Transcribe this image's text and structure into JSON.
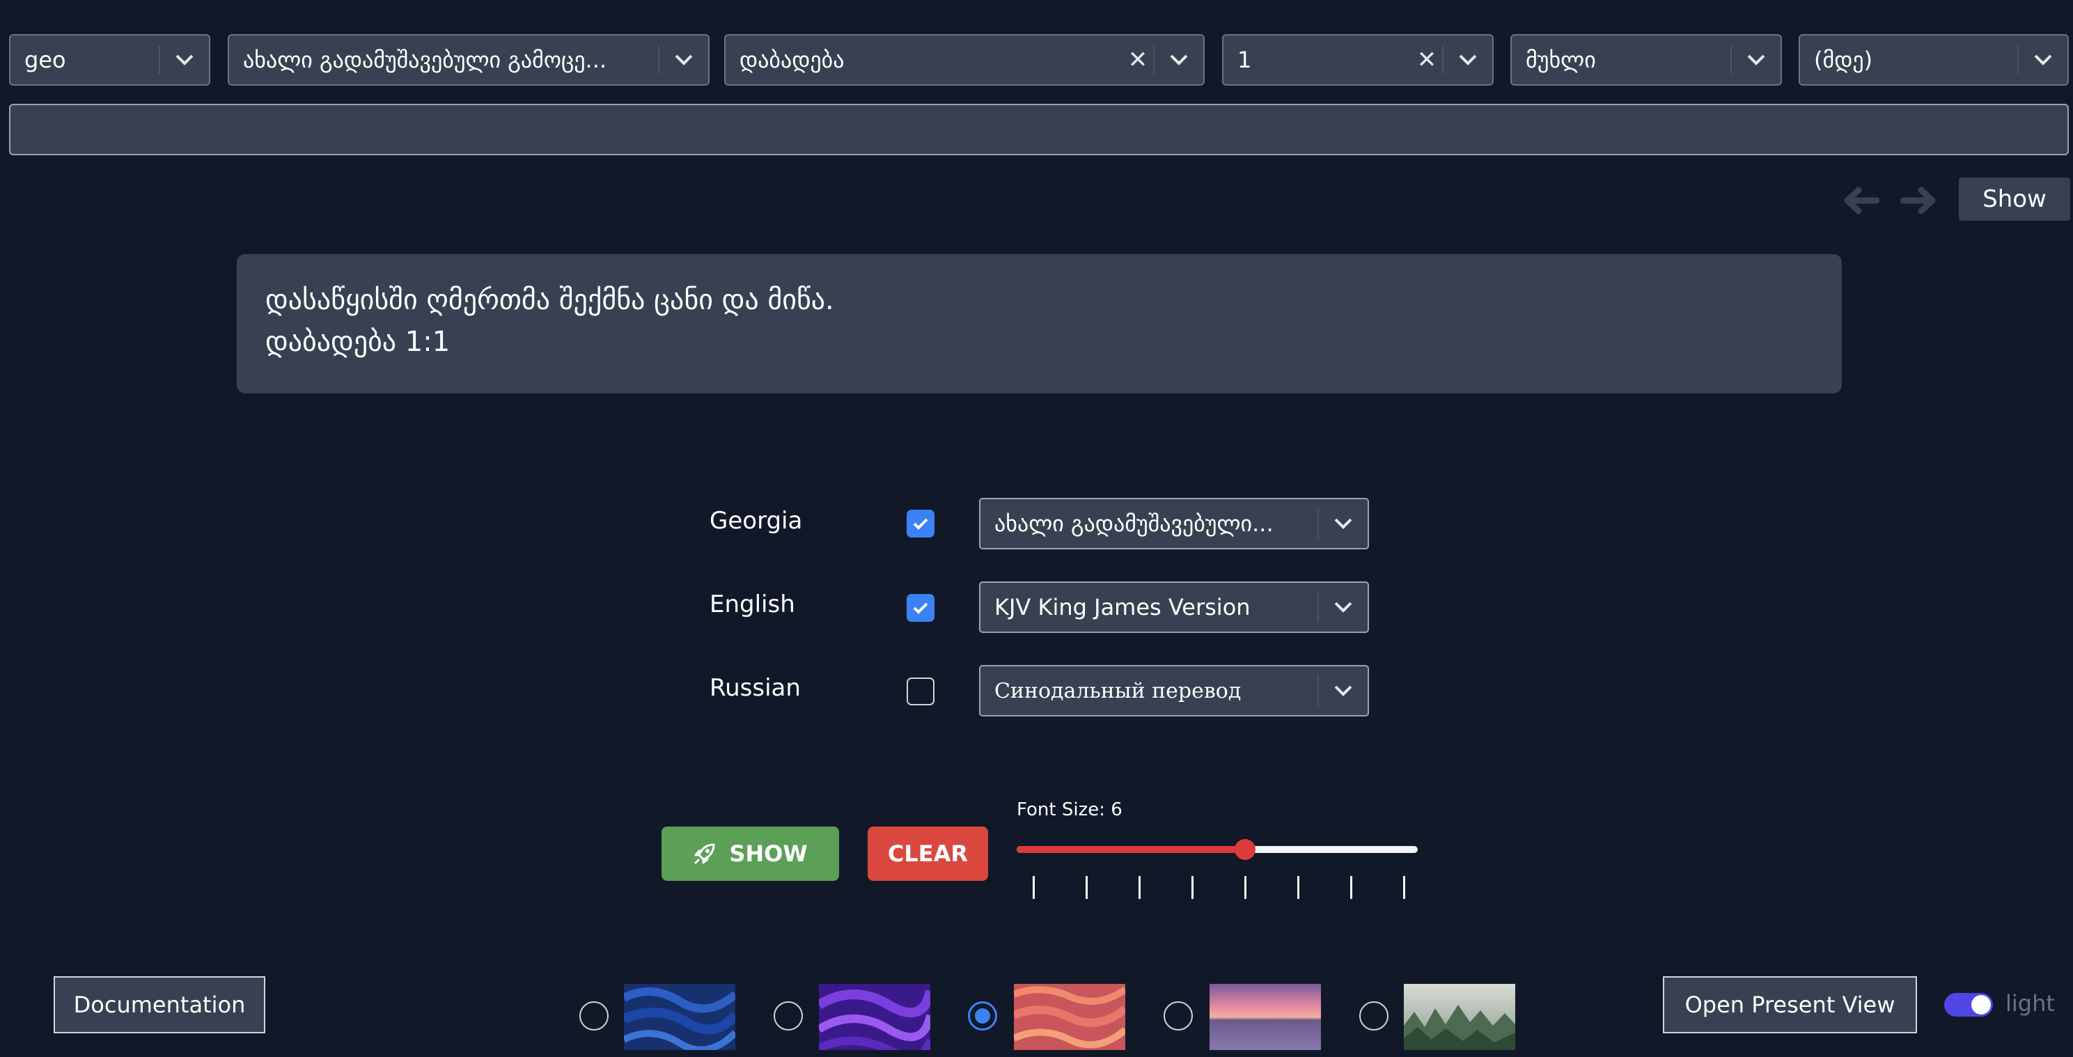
{
  "top_selects": {
    "language": "geo",
    "translation": "ახალი გადამუშავებული გამოცე...",
    "book": "დაბადება",
    "chapter": "1",
    "verse": "მუხლი",
    "verse_to": "(მდე)"
  },
  "search": {
    "value": ""
  },
  "nav": {
    "show_label": "Show"
  },
  "verse_display": {
    "text": "დასაწყისში ღმერთმა შექმნა ცანი და მიწა.",
    "reference": "დაბადება 1:1"
  },
  "translations": [
    {
      "language": "Georgia",
      "checked": true,
      "version": "ახალი გადამუშავებული..."
    },
    {
      "language": "English",
      "checked": true,
      "version": "KJV King James Version"
    },
    {
      "language": "Russian",
      "checked": false,
      "version": "Синодальный перевод"
    }
  ],
  "controls": {
    "show_label": "SHOW",
    "clear_label": "CLEAR",
    "font_size_label": "Font Size: 6",
    "font_size_fraction": 0.57
  },
  "footer": {
    "documentation_label": "Documentation",
    "present_view_label": "Open Present View",
    "theme_label": "light",
    "selected_background": 3
  },
  "colors": {
    "background": "#111827",
    "panel": "#374151",
    "accent_blue": "#3b82f6",
    "show_green": "#5c9f56",
    "clear_red": "#d9473f"
  }
}
